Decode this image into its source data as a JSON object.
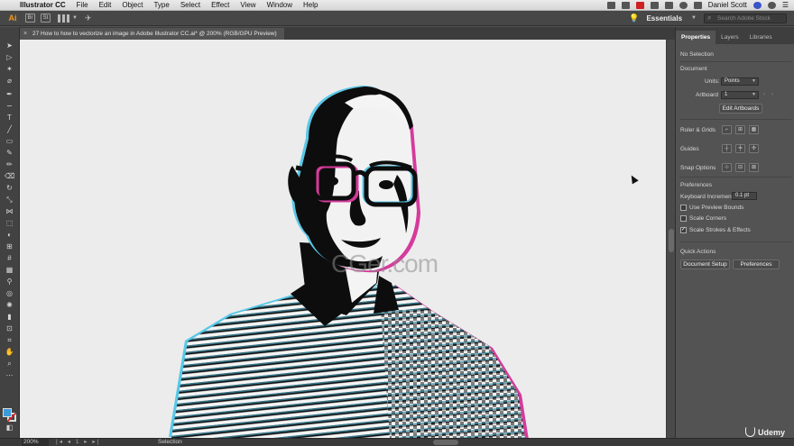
{
  "menubar": {
    "app_name": "Illustrator CC",
    "items": [
      "File",
      "Edit",
      "Object",
      "Type",
      "Select",
      "Effect",
      "View",
      "Window",
      "Help"
    ],
    "user_name": "Daniel Scott"
  },
  "appbar": {
    "logo": "Ai",
    "bridge_label": "Br",
    "stock_label": "St",
    "workspace_label": "Essentials",
    "search_placeholder": "Search Adobe Stock"
  },
  "document_tab": {
    "title": "27 How to how to vectorize an image in Adobe Illustrator CC.ai* @ 200% (RGB/GPU Preview)"
  },
  "artwork": {
    "description_colors": {
      "ink": "#0d0d0d",
      "cyan": "#58c8e8",
      "magenta": "#d63a9c",
      "paper": "#ececec"
    }
  },
  "watermark": "CGer.com",
  "panel": {
    "tabs": [
      "Properties",
      "Layers",
      "Libraries"
    ],
    "selection_label": "No Selection",
    "document_heading": "Document",
    "units_label": "Units:",
    "units_value": "Points",
    "artboard_label": "Artboard",
    "artboard_value": "1",
    "edit_artboards_label": "Edit Artboards",
    "ruler_grids_label": "Ruler & Grids",
    "guides_label": "Guides",
    "snap_options_label": "Snap Options",
    "preferences_heading": "Preferences",
    "keyboard_increment_label": "Keyboard Increment:",
    "keyboard_increment_value": "0.1 pt",
    "use_preview_bounds_label": "Use Preview Bounds",
    "scale_corners_label": "Scale Corners",
    "scale_strokes_label": "Scale Strokes & Effects",
    "quick_actions_heading": "Quick Actions",
    "document_setup_label": "Document Setup",
    "preferences_button_label": "Preferences",
    "checkbox_states": {
      "use_preview_bounds": false,
      "scale_corners": false,
      "scale_strokes": true
    }
  },
  "statusbar": {
    "zoom": "200%",
    "artboard_nav": "|◂ ◂ 1 ▸ ▸|",
    "current_tool": "Selection"
  },
  "branding": {
    "udemy_label": "Udemy"
  }
}
